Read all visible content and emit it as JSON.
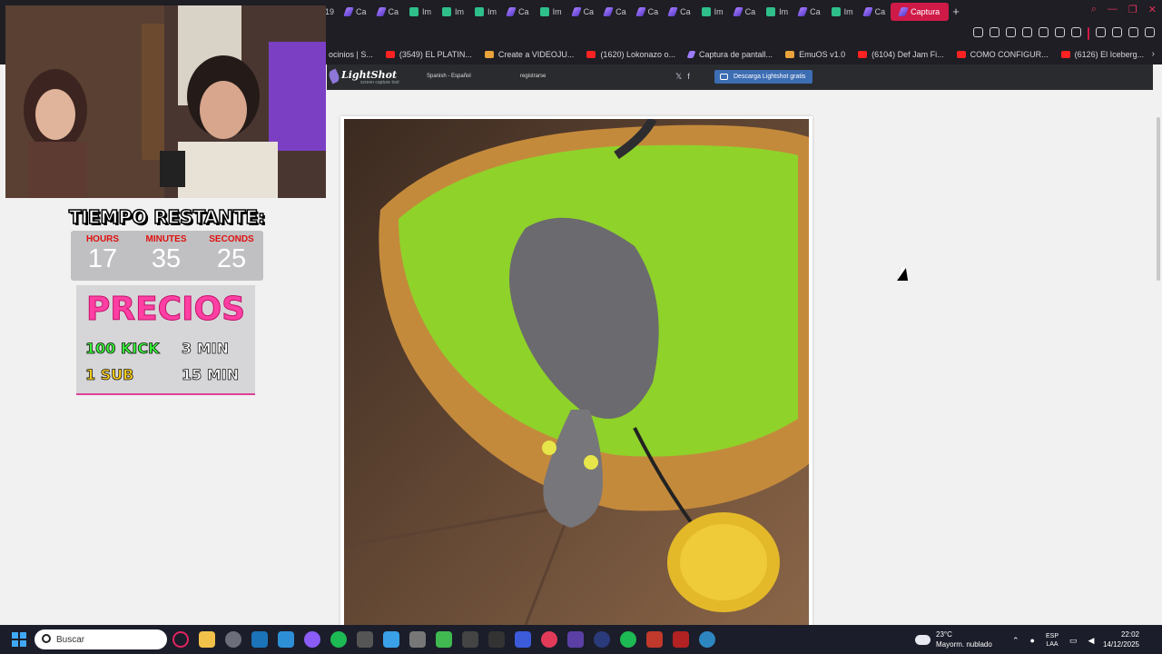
{
  "browser": {
    "tabs": [
      {
        "label": "19",
        "icon": "none"
      },
      {
        "label": "Ca",
        "icon": "pen"
      },
      {
        "label": "Ca",
        "icon": "pen"
      },
      {
        "label": "Im",
        "icon": "img"
      },
      {
        "label": "Im",
        "icon": "img"
      },
      {
        "label": "Im",
        "icon": "img"
      },
      {
        "label": "Ca",
        "icon": "pen"
      },
      {
        "label": "Im",
        "icon": "img"
      },
      {
        "label": "Ca",
        "icon": "pen"
      },
      {
        "label": "Ca",
        "icon": "pen"
      },
      {
        "label": "Ca",
        "icon": "pen"
      },
      {
        "label": "Ca",
        "icon": "pen"
      },
      {
        "label": "Im",
        "icon": "img"
      },
      {
        "label": "Ca",
        "icon": "pen"
      },
      {
        "label": "Im",
        "icon": "img"
      },
      {
        "label": "Ca",
        "icon": "pen"
      },
      {
        "label": "Im",
        "icon": "img"
      },
      {
        "label": "Ca",
        "icon": "pen"
      }
    ],
    "active_tab": "Captura",
    "new_tab": "+",
    "bookmarks": [
      {
        "label": "ocinios | S...",
        "icon": "none"
      },
      {
        "label": "(3549) EL PLATIN...",
        "icon": "yt"
      },
      {
        "label": "Create a VIDEOJU...",
        "icon": "gen"
      },
      {
        "label": "(1620) Lokonazo o...",
        "icon": "yt"
      },
      {
        "label": "Captura de pantall...",
        "icon": "pen"
      },
      {
        "label": "EmuOS v1.0",
        "icon": "gen"
      },
      {
        "label": "(6104) Def Jam Fi...",
        "icon": "yt"
      },
      {
        "label": "COMO CONFIGUR...",
        "icon": "yt"
      },
      {
        "label": "(6126) El Iceberg...",
        "icon": "yt"
      }
    ],
    "bookmarks_more": "›"
  },
  "lightshot": {
    "logo": "LightShot",
    "tagline": "screen capture tool",
    "language": "Spanish - Español",
    "register": "registrarse",
    "social": [
      "𝕏",
      "f"
    ],
    "download_button": "Descarga Lightshot gratis"
  },
  "overlay": {
    "timer_title": "TIEMPO RESTANTE:",
    "hours_label": "HOURS",
    "minutes_label": "MINUTES",
    "seconds_label": "SECONDS",
    "hours": "17",
    "minutes": "35",
    "seconds": "25",
    "precios_title": "PRECIOS",
    "kick_label": "100 KICK",
    "kick_time": "3 MIN",
    "sub_label": "1 SUB",
    "sub_time": "15 MIN"
  },
  "taskbar": {
    "search_placeholder": "Buscar",
    "weather_temp": "23°C",
    "weather_desc": "Mayorm. nublado",
    "lang_top": "ESP",
    "lang_bottom": "LAA",
    "time": "22:02",
    "date": "14/12/2025"
  },
  "colors": {
    "active_tab": "#cf1a48",
    "precios_pink": "#ff3fa3",
    "kick_green": "#39ff3a",
    "sub_yellow": "#ffd21a",
    "timer_red": "#e01010"
  }
}
